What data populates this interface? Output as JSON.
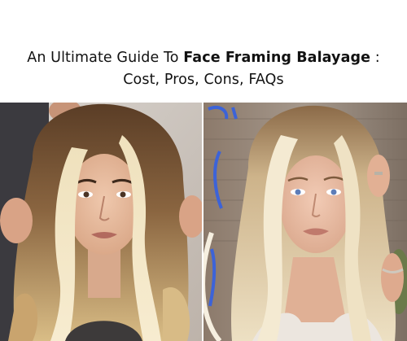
{
  "header": {
    "title_prefix": "An Ultimate Guide To ",
    "title_bold": "Face Framing Balayage",
    "title_suffix": " :",
    "subtitle": "Cost, Pros, Cons, FAQs"
  },
  "images": {
    "left": "left-balayage-photo",
    "right": "right-balayage-photo"
  },
  "colors": {
    "background": "#ffffff",
    "text": "#111111",
    "hair_blonde": "#e8d2a3",
    "hair_dark": "#6b4a2e",
    "skin": "#e3b79a"
  }
}
